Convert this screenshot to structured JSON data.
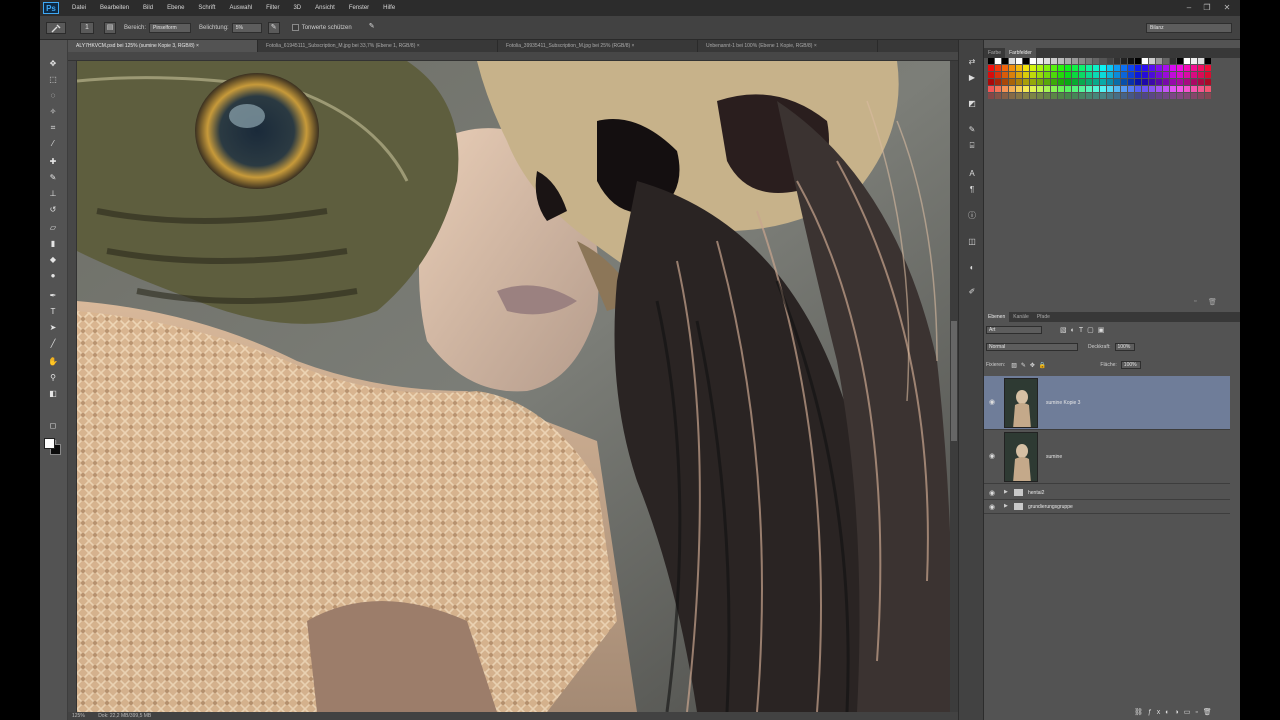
{
  "app": {
    "logo": "Ps"
  },
  "menu": [
    "Datei",
    "Bearbeiten",
    "Bild",
    "Ebene",
    "Schrift",
    "Auswahl",
    "Filter",
    "3D",
    "Ansicht",
    "Fenster",
    "Hilfe"
  ],
  "window_controls": {
    "minimize": "–",
    "restore": "❐",
    "close": "✕"
  },
  "options_bar": {
    "tool_icon": "eyedropper-icon",
    "size_value": "1",
    "mode_label": "Bereich:",
    "mode_value": "Pinselform",
    "strength_label": "Belichtung:",
    "strength_value": "5%",
    "protect_label": "Tonwerte schützen",
    "workspace": "Bilanz"
  },
  "doc_tabs": [
    {
      "label": "ALY7HKVCM.psd bei 125% (sumine Kopie 3, RGB/8) ×",
      "active": true
    },
    {
      "label": "Fotolia_61945111_Subscription_M.jpg bei 33,7% (Ebene 1, RGB/8) ×",
      "active": false
    },
    {
      "label": "Fotolia_39935411_Subscription_M.jpg bei 25% (RGB/8) ×",
      "active": false
    },
    {
      "label": "Unbenannt-1 bei 100% (Ebene 1 Kopie, RGB/8) ×",
      "active": false
    }
  ],
  "status": {
    "zoom": "125%",
    "doc": "Dok: 22,2 MB/399,5 MB"
  },
  "panels": {
    "swatches_tabs": [
      "Farbe",
      "Farbfelder"
    ],
    "swatches_active": 1,
    "layers_tabs": [
      "Ebenen",
      "Kanäle",
      "Pfade"
    ],
    "layers_active": 0,
    "filter_kind": "Art",
    "blend_mode": "Normal",
    "opacity_label": "Deckkraft:",
    "opacity": "100%",
    "lock_label": "Fixieren:",
    "fill_label": "Fläche:",
    "fill": "100%",
    "layers": [
      {
        "name": "sumine Kopie 3",
        "type": "image",
        "selected": true
      },
      {
        "name": "sumine",
        "type": "image",
        "selected": false
      },
      {
        "name": "hentai2",
        "type": "group",
        "selected": false
      },
      {
        "name": "grundierungsgruppe",
        "type": "group",
        "selected": false
      }
    ]
  },
  "colors": {
    "accent": "#3fa9f5",
    "layer_selected": "#6f7d99",
    "panel_bg": "#535353",
    "chrome": "#2c2c2c"
  }
}
